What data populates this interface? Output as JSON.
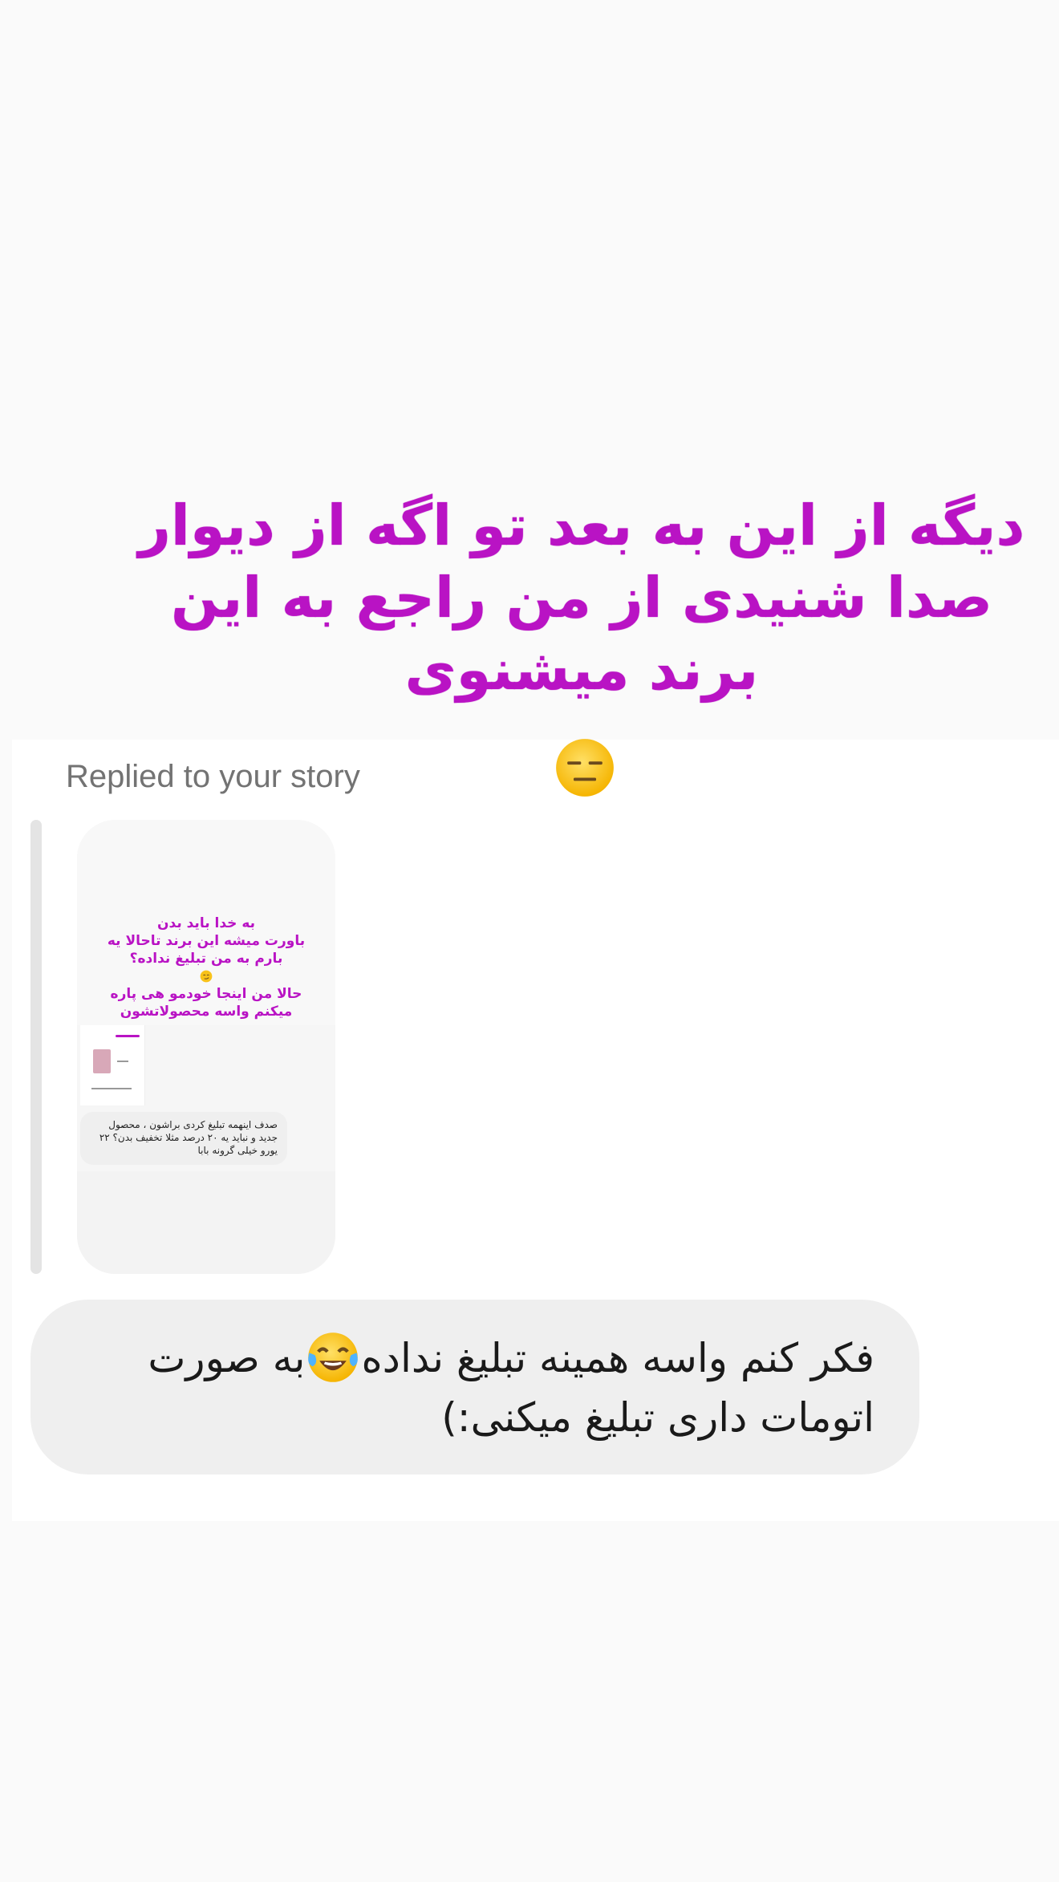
{
  "story_overlay": {
    "text_line1": "دیگه از این به بعد تو اگه از دیوار",
    "text_line2": "صدا شنیدی از من راجع به این",
    "text_line3": "برند میشنوی",
    "emoji": "expressionless-face-emoji",
    "text_color": "#b913c4"
  },
  "reply": {
    "label": "Replied to your story"
  },
  "story_preview": {
    "line1": "به خدا باید بدن",
    "line2": "باورت میشه این برند تاحالا یه",
    "line3": "بارم به من تبلیغ نداده؟",
    "line4": "حالا من اینجا خودمو هی پاره",
    "line5": "میکنم واسه محصولاتشون",
    "nested_comment_line1": "صدف اینهمه تبلیغ کردی براشون ، محصول",
    "nested_comment_line2": "جدید و نباید یه ۲۰ درصد مثلا تخفیف بدن؟ ۲۲",
    "nested_comment_line3": "یورو خیلی گرونه بابا"
  },
  "message": {
    "part1": "فکر کنم واسه همینه تبلیغ نداده",
    "emoji": "face-with-tears-of-joy-emoji",
    "part2": "به صورت اتومات داری تبلیغ میکنی:)"
  }
}
